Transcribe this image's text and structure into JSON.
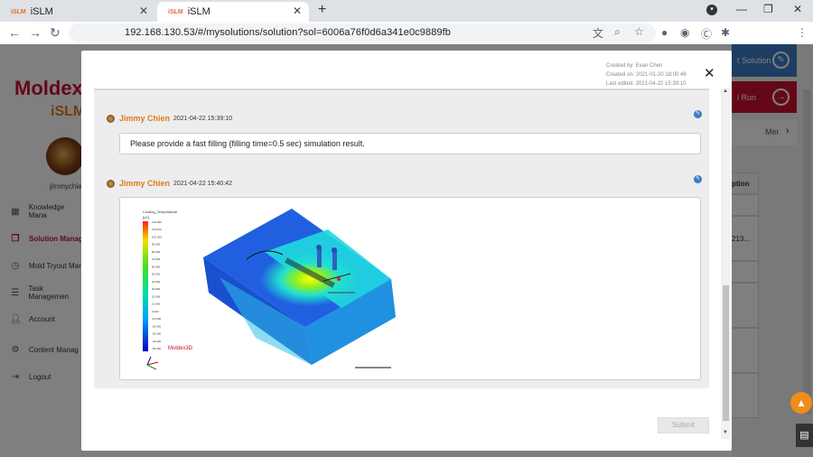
{
  "browser": {
    "tabs": [
      {
        "logo": "iSLM",
        "title": "iSLM",
        "active": false
      },
      {
        "logo": "iSLM",
        "title": "iSLM",
        "active": true
      }
    ],
    "url": "192.168.130.53/#/mysolutions/solution?sol=6006a76f0d6a341e0c9889fb"
  },
  "brand": {
    "name": "Moldex",
    "product": "iSLM"
  },
  "user": {
    "name": "jimmychien"
  },
  "sidebar": {
    "items": [
      {
        "label": "Knowledge Mana",
        "icon": "grid-icon"
      },
      {
        "label": "Solution Manag",
        "icon": "copy-icon",
        "active": true
      },
      {
        "label": "Mold Tryout Man",
        "icon": "clock-icon"
      },
      {
        "label": "Task Managemen",
        "icon": "task-icon"
      },
      {
        "label": "Account",
        "icon": "user-icon"
      },
      {
        "label": "Content Manag",
        "icon": "user-settings-icon"
      },
      {
        "label": "Logout",
        "icon": "logout-icon"
      }
    ]
  },
  "right_panel": {
    "solution_button": "t Solution",
    "trial_button": "l Run",
    "more_label": "Mer",
    "table_header": "ption",
    "table_cells": [
      "",
      "213...",
      "",
      "",
      "",
      ""
    ]
  },
  "modal": {
    "created_by": "Created by: Evan Chen",
    "created_on": "Created on: 2021-01-20 18:00:46",
    "last_edited": "Last edited: 2021-04-22 15:39:10",
    "comments": [
      {
        "author": "Jimmy Chien",
        "date": "2021-04-22 15:39:10",
        "text": "Please provide a fast filling (filling time=0.5 sec) simulation result."
      },
      {
        "author": "Jimmy Chien",
        "date": "2021-04-22 15:40:42",
        "image": {
          "legend_title": "Cooling_Temperature",
          "legend_unit": "[oC]",
          "legend_values": [
            "120.000",
            "110.000",
            "100.000",
            "90.000",
            "80.000",
            "70.000",
            "60.000",
            "50.000",
            "40.000",
            "30.000",
            "20.000",
            "10.000",
            "0.000",
            "-10.000",
            "-20.000",
            "-30.000",
            "-40.000",
            "-50.000"
          ],
          "watermark": "Moldex3D"
        }
      }
    ],
    "submit_label": "Submit"
  },
  "colors": {
    "brand_red": "#c8102e",
    "brand_orange": "#e07b1a",
    "accent_blue": "#3b7dc4"
  }
}
